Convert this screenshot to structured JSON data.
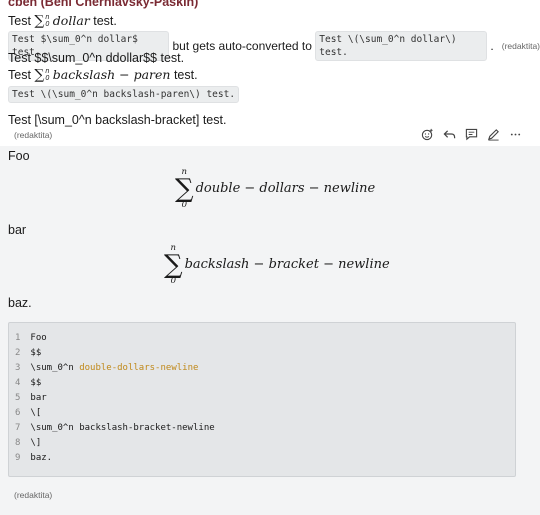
{
  "message1": {
    "author": "cben (Beni Cherniavsky-Paškin)",
    "line1": {
      "prefix": "Test ",
      "sum_sup": "n",
      "sum_sub": "0",
      "math": "dollar",
      "suffix": " test."
    },
    "line2": {
      "code1": "Test $\\sum_0^n dollar$ test.",
      "middle": " but gets auto-converted to ",
      "code2": "Test \\(\\sum_0^n dollar\\) test.",
      "dot": ".",
      "edited": "(redaktita)"
    },
    "line3": "Test $$\\sum_0^n ddollar$$ test.",
    "line4": {
      "prefix": "Test ",
      "sum_sup": "n",
      "sum_sub": "0",
      "math": "backslash − paren",
      "suffix": " test."
    },
    "line5": "Test \\(\\sum_0^n backslash-paren\\) test.",
    "line6": "Test [\\sum_0^n backslash-bracket] test.",
    "edited": "(redaktita)"
  },
  "toolbar": {
    "icons": [
      "emoji-add-icon",
      "reply-icon",
      "comment-icon",
      "edit-icon",
      "more-icon"
    ]
  },
  "message2": {
    "foo": "Foo",
    "display1": {
      "sup": "n",
      "sub": "0",
      "body": "double − dollars − newline"
    },
    "bar": "bar",
    "display2": {
      "sup": "n",
      "sub": "0",
      "body": "backslash − bracket − newline"
    },
    "baz": "baz.",
    "code_lines": [
      {
        "n": "1",
        "text": "Foo",
        "hl": ""
      },
      {
        "n": "2",
        "text": "$$",
        "hl": ""
      },
      {
        "n": "3",
        "text": "\\sum_0^n ",
        "hl": "double-dollars-newline"
      },
      {
        "n": "4",
        "text": "$$",
        "hl": ""
      },
      {
        "n": "5",
        "text": "bar",
        "hl": ""
      },
      {
        "n": "6",
        "text": "\\[",
        "hl": ""
      },
      {
        "n": "7",
        "text": "\\sum_0^n backslash-bracket-newline",
        "hl": ""
      },
      {
        "n": "8",
        "text": "\\]",
        "hl": ""
      },
      {
        "n": "9",
        "text": "baz.",
        "hl": ""
      }
    ],
    "edited": "(redaktita)"
  }
}
